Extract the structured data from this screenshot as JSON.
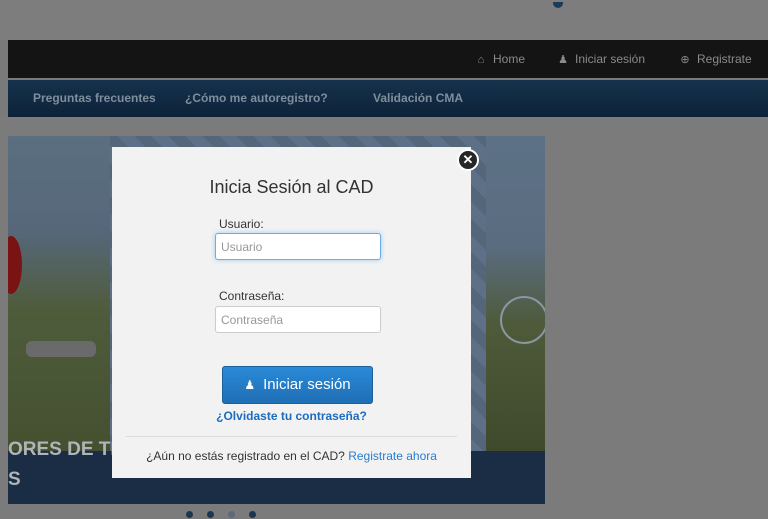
{
  "colors": {
    "overlay": "#7a7a7a",
    "navbar_top": "#141414",
    "navbar_sub": "#0d2238",
    "primary_button": "#1f6fb5",
    "link": "#1c6cc0",
    "modal_bg": "#f2f2f2"
  },
  "top_nav": {
    "items": [
      {
        "label": "Home",
        "icon": "home-icon"
      },
      {
        "label": "Iniciar sesión",
        "icon": "user-icon"
      },
      {
        "label": "Registrate",
        "icon": "plus-circle-icon"
      }
    ]
  },
  "sub_nav": {
    "items": [
      {
        "label": "Preguntas frecuentes"
      },
      {
        "label": "¿Cómo me autoregistro?"
      },
      {
        "label": "Validación CMA"
      }
    ]
  },
  "carousel": {
    "caption_line1": "ORES DE TI",
    "caption_line2": "S",
    "active_slide": 3,
    "slide_count": 4
  },
  "login_modal": {
    "title": "Inicia Sesión al CAD",
    "close_icon": "close-icon",
    "username": {
      "label": "Usuario:",
      "placeholder": "Usuario",
      "value": ""
    },
    "password": {
      "label": "Contraseña:",
      "placeholder": "Contraseña",
      "value": ""
    },
    "submit_label": "Iniciar sesión",
    "submit_icon": "user-icon",
    "forgot_link": "¿Olvidaste tu contraseña?",
    "register_prompt": "¿Aún no estás registrado en el CAD?",
    "register_link": "Registrate ahora"
  }
}
